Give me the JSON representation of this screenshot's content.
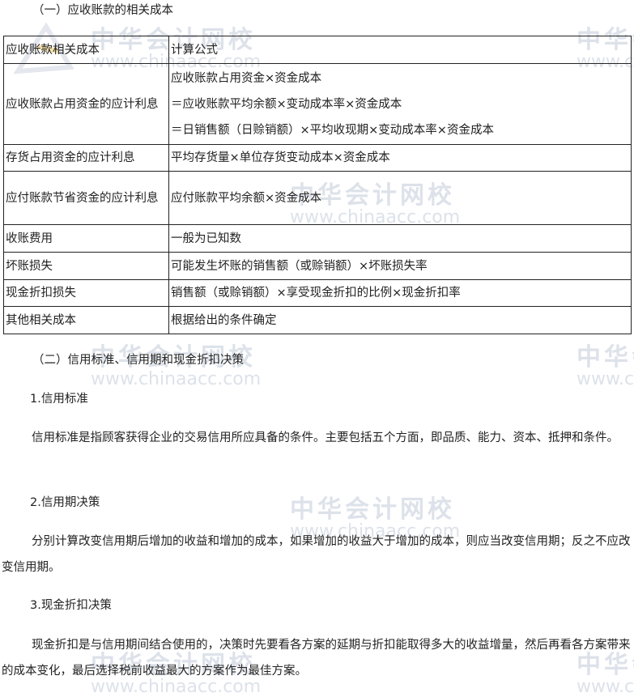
{
  "watermark": {
    "name": "中华会计网校",
    "url": "www.chinaacc.com"
  },
  "section1_title": "（一）应收账款的相关成本",
  "table": {
    "headers": [
      "应收账款相关成本",
      "计算公式"
    ],
    "rows": [
      {
        "item": "应收账款占用资金的应计利息",
        "formula": [
          "应收账款占用资金×资金成本",
          "＝应收账款平均余额×变动成本率×资金成本",
          "＝日销售额（日赊销额）×平均收现期×变动成本率×资金成本"
        ]
      },
      {
        "item": "存货占用资金的应计利息",
        "formula": [
          "平均存货量×单位存货变动成本×资金成本"
        ]
      },
      {
        "item": "应付账款节省资金的应计利息",
        "formula": [
          "应付账款平均余额×资金成本"
        ]
      },
      {
        "item": "收账费用",
        "formula": [
          "一般为已知数"
        ]
      },
      {
        "item": "坏账损失",
        "formula": [
          "可能发生坏账的销售额（或赊销额）×坏账损失率"
        ]
      },
      {
        "item": "现金折扣损失",
        "formula": [
          "销售额（或赊销额）×享受现金折扣的比例×现金折扣率"
        ]
      },
      {
        "item": "其他相关成本",
        "formula": [
          "根据给出的条件确定"
        ]
      }
    ]
  },
  "section2_title": "（二）信用标准、信用期和现金折扣决策",
  "sub1": {
    "title": "1.信用标准",
    "text": "信用标准是指顾客获得企业的交易信用所应具备的条件。主要包括五个方面，即品质、能力、资本、抵押和条件。"
  },
  "sub2": {
    "title": "2.信用期决策",
    "text": "分别计算改变信用期后增加的收益和增加的成本，如果增加的收益大于增加的成本，则应当改变信用期；反之不应改变信用期。"
  },
  "sub3": {
    "title": "3.现金折扣决策",
    "text": "现金折扣是与信用期间结合使用的，决策时先要看各方案的延期与折扣能取得多大的收益增量，然后再看各方案带来的成本变化，最后选择税前收益最大的方案作为最佳方案。"
  }
}
